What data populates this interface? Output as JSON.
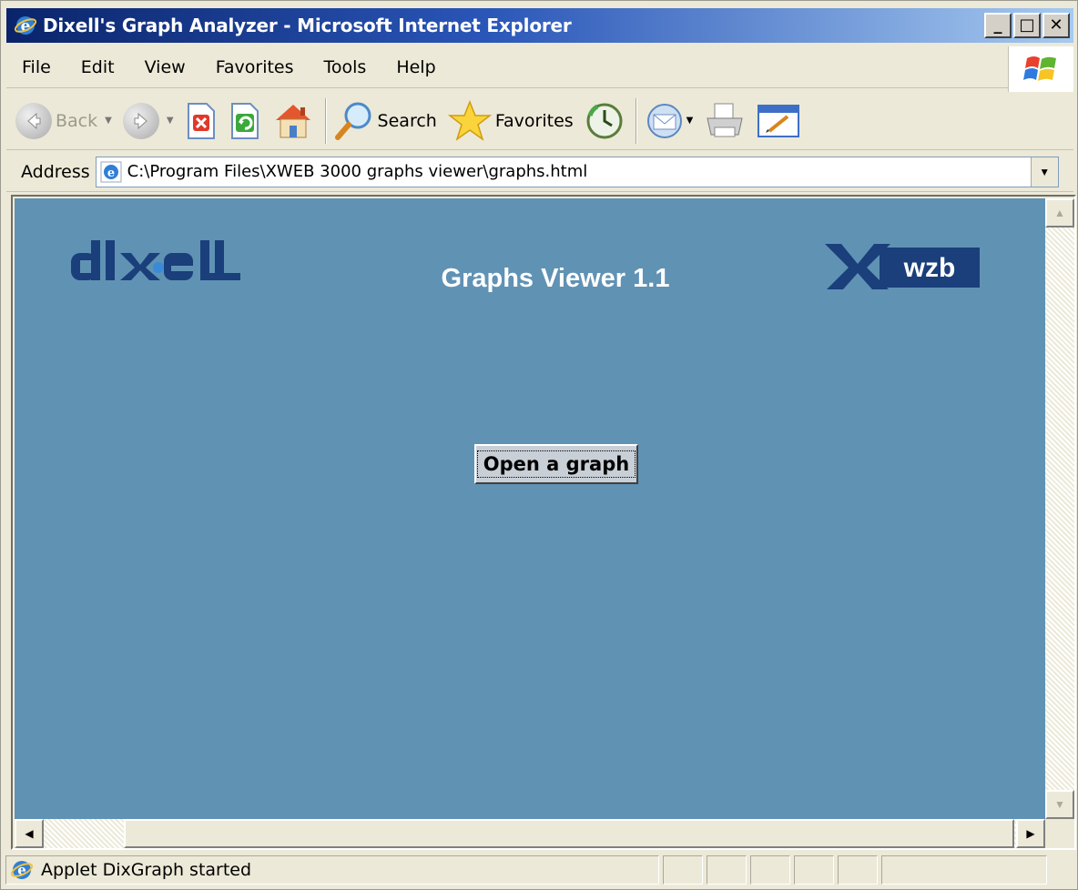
{
  "window": {
    "title": "Dixell's Graph Analyzer - Microsoft Internet Explorer",
    "min_label": "_",
    "max_label": "□",
    "close_label": "✕"
  },
  "menubar": {
    "items": [
      "File",
      "Edit",
      "View",
      "Favorites",
      "Tools",
      "Help"
    ]
  },
  "toolbar": {
    "back_label": "Back",
    "search_label": "Search",
    "favorites_label": "Favorites",
    "icons": [
      "back-icon",
      "forward-icon",
      "stop-icon",
      "refresh-icon",
      "home-icon",
      "search-icon",
      "favorites-icon",
      "history-icon",
      "mail-icon",
      "print-icon",
      "edit-icon"
    ]
  },
  "address": {
    "label": "Address",
    "value": "C:\\Program Files\\XWEB 3000 graphs viewer\\graphs.html"
  },
  "page": {
    "title": "Graphs Viewer 1.1",
    "open_button": "Open a graph",
    "logo_left": "dixell",
    "logo_right": "xweb",
    "background_color": "#6092b4",
    "logo_color": "#1a3f7a"
  },
  "status": {
    "text": "Applet DixGraph started"
  }
}
